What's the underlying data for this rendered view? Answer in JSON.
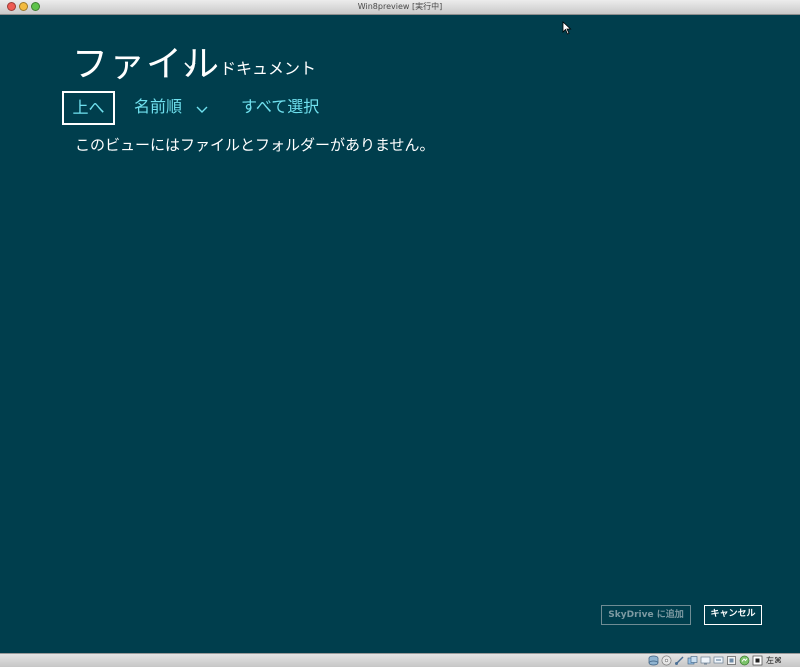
{
  "window": {
    "title": "Win8preview [実行中]"
  },
  "header": {
    "title": "ファイル",
    "location": "ドキュメント",
    "title_chevron_icon": "chevron-down-icon"
  },
  "commands": {
    "up_label": "上へ",
    "sort_label": "名前順",
    "select_all_label": "すべて選択"
  },
  "content": {
    "empty_message": "このビューにはファイルとフォルダーがありません。"
  },
  "footer": {
    "skydrive_label": "SkyDrive に追加",
    "cancel_label": "キャンセル"
  },
  "statusbar": {
    "host_key": "左⌘",
    "icons": [
      "hard-disk-icon",
      "optical-drive-icon",
      "usb-icon",
      "shared-folder-icon",
      "display-icon",
      "network-icon",
      "capture-icon",
      "mouse-integration-icon"
    ]
  },
  "colors": {
    "app_background": "#003e4d",
    "accent": "#6fe0ee",
    "text": "#ffffff"
  }
}
